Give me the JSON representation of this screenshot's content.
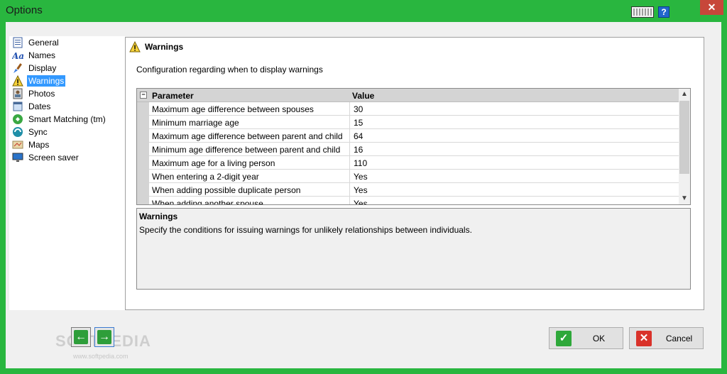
{
  "window": {
    "title": "Options"
  },
  "titlebar": {
    "close_glyph": "✕",
    "help_glyph": "?"
  },
  "nav": {
    "items": [
      {
        "label": "General",
        "icon": "document-icon"
      },
      {
        "label": "Names",
        "icon": "font-icon"
      },
      {
        "label": "Display",
        "icon": "paintbrush-icon"
      },
      {
        "label": "Warnings",
        "icon": "warning-icon",
        "selected": true
      },
      {
        "label": "Photos",
        "icon": "photo-icon"
      },
      {
        "label": "Dates",
        "icon": "calendar-icon"
      },
      {
        "label": "Smart Matching (tm)",
        "icon": "smart-matching-icon"
      },
      {
        "label": "Sync",
        "icon": "sync-icon"
      },
      {
        "label": "Maps",
        "icon": "map-icon"
      },
      {
        "label": "Screen saver",
        "icon": "monitor-icon"
      }
    ]
  },
  "panel": {
    "title": "Warnings",
    "description": "Configuration regarding when to display warnings",
    "grid": {
      "collapse_glyph": "−",
      "headers": {
        "parameter": "Parameter",
        "value": "Value"
      },
      "rows": [
        {
          "parameter": "Maximum age difference between spouses",
          "value": "30"
        },
        {
          "parameter": "Minimum marriage age",
          "value": "15"
        },
        {
          "parameter": "Maximum age difference between parent and child",
          "value": "64"
        },
        {
          "parameter": "Minimum age difference between parent and child",
          "value": "16"
        },
        {
          "parameter": "Maximum age for a living person",
          "value": "110"
        },
        {
          "parameter": "When entering a 2-digit year",
          "value": "Yes"
        },
        {
          "parameter": "When adding possible duplicate person",
          "value": "Yes"
        },
        {
          "parameter": "When adding another spouse",
          "value": "Yes"
        }
      ]
    },
    "help": {
      "title": "Warnings",
      "text": "Specify the conditions for issuing warnings for unlikely relationships between individuals."
    }
  },
  "footer": {
    "back_glyph": "←",
    "forward_glyph": "→",
    "ok_label": "OK",
    "ok_glyph": "✓",
    "cancel_label": "Cancel",
    "cancel_glyph": "✕",
    "watermark": "SOFTPEDIA",
    "watermark_sub": "www.softpedia.com"
  }
}
